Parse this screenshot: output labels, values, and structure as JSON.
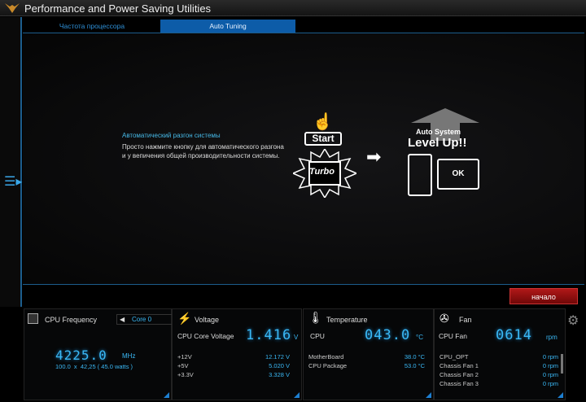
{
  "title": "Performance and Power Saving Utilities",
  "tabs": [
    {
      "label": "Частота процессора"
    },
    {
      "label": "Auto Tuning"
    }
  ],
  "auto": {
    "heading": "Автоматический разгон системы",
    "desc": "Просто нажмите кнопку для автоматического разгона и у вепичения общей производительности системы.",
    "start_label": "Start",
    "turbo_label": "Turbo",
    "auto_system": "Auto System",
    "level_up": "Level Up!!",
    "ok": "OK",
    "button": "начало"
  },
  "cpu": {
    "title": "CPU Frequency",
    "core": "Core 0",
    "value": "4225.0",
    "unit": "MHz",
    "detail": "100.0  x  42,25 ( 45.0 watts )"
  },
  "voltage": {
    "title": "Voltage",
    "main_label": "CPU Core Voltage",
    "main_value": "1.416",
    "main_unit": "V",
    "rows": [
      {
        "label": "+12V",
        "value": "12.172  V"
      },
      {
        "label": "+5V",
        "value": "5.020  V"
      },
      {
        "label": "+3.3V",
        "value": "3.328  V"
      }
    ]
  },
  "temp": {
    "title": "Temperature",
    "main_label": "CPU",
    "main_value": "043.0",
    "main_unit": "°C",
    "rows": [
      {
        "label": "MotherBoard",
        "value": "38.0 °C"
      },
      {
        "label": "CPU Package",
        "value": "53.0 °C"
      }
    ]
  },
  "fan": {
    "title": "Fan",
    "main_label": "CPU Fan",
    "main_value": "0614",
    "main_unit": "rpm",
    "rows": [
      {
        "label": "CPU_OPT",
        "value": "0  rpm"
      },
      {
        "label": "Chassis Fan 1",
        "value": "0  rpm"
      },
      {
        "label": "Chassis Fan 2",
        "value": "0  rpm"
      },
      {
        "label": "Chassis Fan 3",
        "value": "0  rpm"
      }
    ]
  }
}
